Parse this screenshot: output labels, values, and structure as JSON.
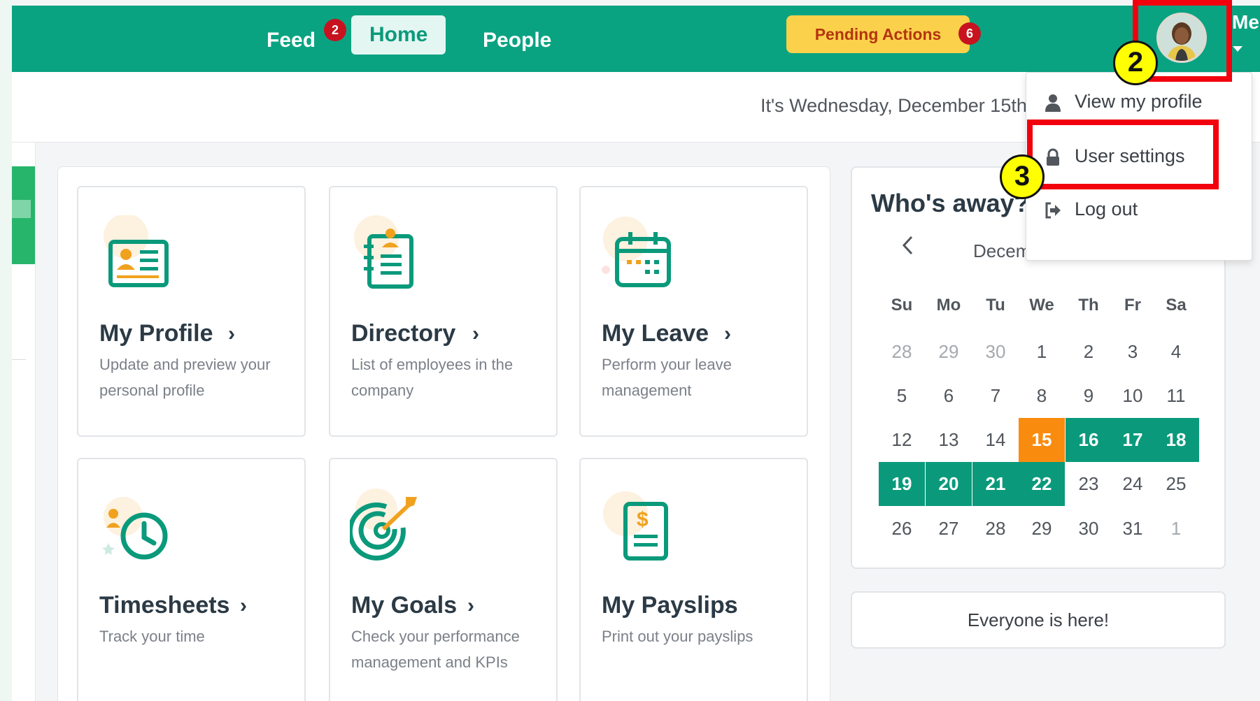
{
  "topnav": {
    "feed": "Feed",
    "feed_badge": "2",
    "home": "Home",
    "people": "People",
    "pending_actions": "Pending Actions",
    "pending_badge": "6",
    "me": "Me"
  },
  "subheader": {
    "date_text": "It's Wednesday, December 15th"
  },
  "dropdown": {
    "items": [
      {
        "label": "View my profile",
        "icon": "user-icon"
      },
      {
        "label": "User settings",
        "icon": "lock-icon"
      },
      {
        "label": "Log out",
        "icon": "logout-icon"
      }
    ]
  },
  "annotations": {
    "step2": "2",
    "step3": "3"
  },
  "cards": [
    {
      "title": "My Profile",
      "desc": "Update and preview your personal profile",
      "icon": "profile-card-icon"
    },
    {
      "title": "Directory",
      "desc": "List of employees in the company",
      "icon": "directory-icon"
    },
    {
      "title": "My Leave",
      "desc": "Perform your leave management",
      "icon": "calendar-icon"
    },
    {
      "title": "Timesheets",
      "desc": "Track your time",
      "icon": "clock-icon"
    },
    {
      "title": "My Goals",
      "desc": "Check your performance management and KPIs",
      "icon": "target-icon"
    },
    {
      "title": "My Payslips",
      "desc": "Print out your payslips",
      "icon": "payslip-icon"
    }
  ],
  "away": {
    "title": "Who's away?",
    "month": "December",
    "weekdays": [
      "Su",
      "Mo",
      "Tu",
      "We",
      "Th",
      "Fr",
      "Sa"
    ],
    "weeks": [
      [
        "28",
        "29",
        "30",
        "1",
        "2",
        "3",
        "4"
      ],
      [
        "5",
        "6",
        "7",
        "8",
        "9",
        "10",
        "11"
      ],
      [
        "12",
        "13",
        "14",
        "15",
        "16",
        "17",
        "18"
      ],
      [
        "19",
        "20",
        "21",
        "22",
        "23",
        "24",
        "25"
      ],
      [
        "26",
        "27",
        "28",
        "29",
        "30",
        "31",
        "1"
      ]
    ],
    "today": "15",
    "leave_days": [
      "16",
      "17",
      "18",
      "19",
      "20",
      "21",
      "22"
    ],
    "everyone_here": "Everyone is here!"
  },
  "colors": {
    "topbar": "#0aa382",
    "accent": "#0a9a7b",
    "today": "#f98c0f",
    "pending": "#fbd14b",
    "badge": "#c6131f",
    "annotation_red": "#f2000e",
    "annotation_yellow": "#ffff00"
  }
}
